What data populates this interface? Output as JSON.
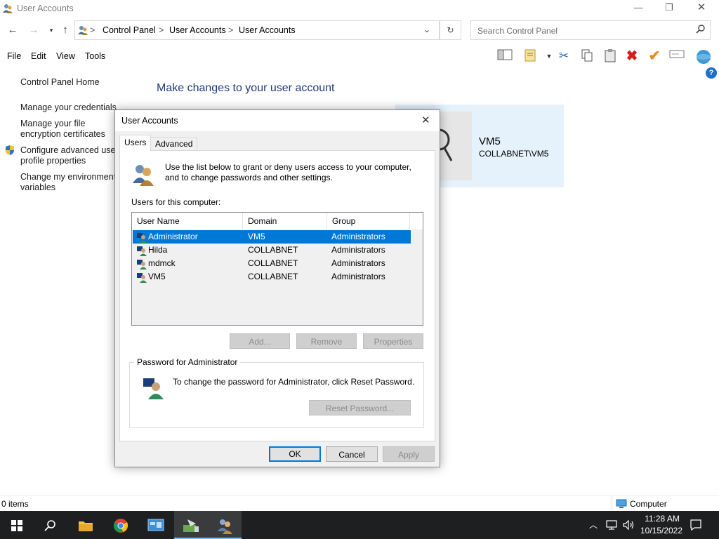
{
  "window": {
    "title": "User Accounts",
    "minimize_glyph": "—",
    "restore_glyph": "❐",
    "close_glyph": "✕"
  },
  "address": {
    "crumbs": [
      "Control Panel",
      "User Accounts",
      "User Accounts"
    ],
    "separator": ">",
    "search_placeholder": "Search Control Panel"
  },
  "menu": {
    "items": [
      "File",
      "Edit",
      "View",
      "Tools"
    ]
  },
  "left_nav": {
    "items": [
      "Control Panel Home",
      "Manage your credentials",
      "Manage your file encryption certificates",
      "Configure advanced user profile properties",
      "Change my environment variables"
    ]
  },
  "main": {
    "heading": "Make changes to your user account",
    "user_name": "VM5",
    "user_domain": "COLLABNET\\VM5"
  },
  "dialog": {
    "title": "User Accounts",
    "tabs": [
      "Users",
      "Advanced"
    ],
    "active_tab": "Users",
    "intro": "Use the list below to grant or deny users access to your computer, and to change passwords and other settings.",
    "list_label": "Users for this computer:",
    "columns": [
      "User Name",
      "Domain",
      "Group"
    ],
    "rows": [
      {
        "name": "Administrator",
        "domain": "VM5",
        "group": "Administrators",
        "selected": true
      },
      {
        "name": "Hilda",
        "domain": "COLLABNET",
        "group": "Administrators",
        "selected": false
      },
      {
        "name": "mdmck",
        "domain": "COLLABNET",
        "group": "Administrators",
        "selected": false
      },
      {
        "name": "VM5",
        "domain": "COLLABNET",
        "group": "Administrators",
        "selected": false
      }
    ],
    "buttons": {
      "add": "Add...",
      "remove": "Remove",
      "properties": "Properties",
      "reset_password": "Reset Password...",
      "ok": "OK",
      "cancel": "Cancel",
      "apply": "Apply"
    },
    "password_group_title": "Password for Administrator",
    "password_text": "To change the password for Administrator, click Reset Password."
  },
  "status": {
    "items_count": "0 items",
    "location": "Computer"
  },
  "taskbar": {
    "time": "11:28 AM",
    "date": "10/15/2022"
  },
  "colors": {
    "accent": "#0078d7",
    "heading": "#1e3b78",
    "taskbar": "#1e1f21"
  }
}
